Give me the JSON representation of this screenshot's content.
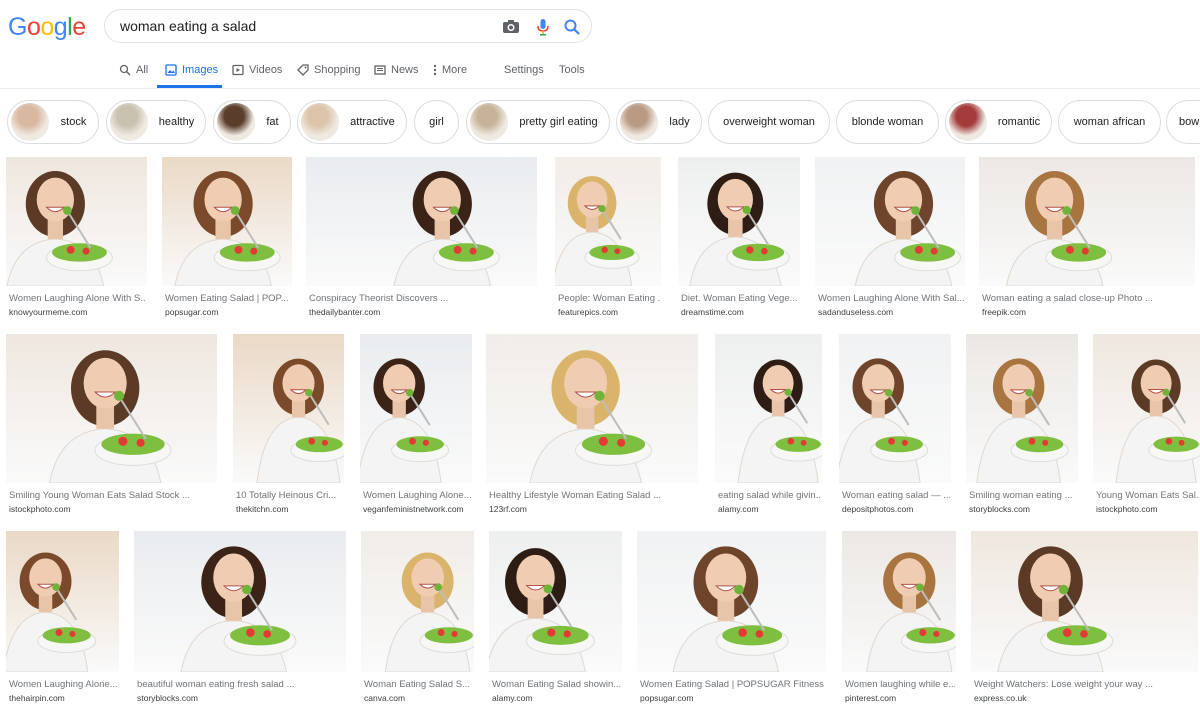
{
  "logo": {
    "text": "Google",
    "letters": [
      {
        "ch": "G",
        "color": "#4285f4"
      },
      {
        "ch": "o",
        "color": "#ea4335"
      },
      {
        "ch": "o",
        "color": "#fbbc05"
      },
      {
        "ch": "g",
        "color": "#4285f4"
      },
      {
        "ch": "l",
        "color": "#34a853"
      },
      {
        "ch": "e",
        "color": "#ea4335"
      }
    ]
  },
  "search": {
    "query": "woman eating a salad",
    "icons": [
      "camera-icon",
      "microphone-icon",
      "search-icon"
    ]
  },
  "tabs": [
    {
      "label": "All",
      "icon": "search-icon"
    },
    {
      "label": "Images",
      "icon": "image-icon",
      "active": true
    },
    {
      "label": "Videos",
      "icon": "play-icon"
    },
    {
      "label": "Shopping",
      "icon": "tag-icon"
    },
    {
      "label": "News",
      "icon": "newspaper-icon"
    },
    {
      "label": "More",
      "icon": "more-vert-icon"
    },
    {
      "label": "Settings"
    },
    {
      "label": "Tools"
    }
  ],
  "chips": [
    {
      "label": "stock",
      "thumb": true
    },
    {
      "label": "healthy",
      "thumb": true
    },
    {
      "label": "fat",
      "thumb": true
    },
    {
      "label": "attractive",
      "thumb": true
    },
    {
      "label": "girl",
      "thumb": false
    },
    {
      "label": "pretty girl eating",
      "thumb": true
    },
    {
      "label": "lady",
      "thumb": true
    },
    {
      "label": "overweight woman",
      "thumb": false
    },
    {
      "label": "blonde woman",
      "thumb": false
    },
    {
      "label": "romantic",
      "thumb": true
    },
    {
      "label": "woman african",
      "thumb": false
    },
    {
      "label": "bow",
      "thumb": false
    }
  ],
  "results": [
    {
      "title": "Women Laughing Alone With S...",
      "source": "knowyourmeme.com"
    },
    {
      "title": "Women Eating Salad | POP...",
      "source": "popsugar.com"
    },
    {
      "title": "Conspiracy Theorist Discovers ...",
      "source": "thedailybanter.com"
    },
    {
      "title": "People: Woman Eating ...",
      "source": "featurepics.com"
    },
    {
      "title": "Diet. Woman Eating Vege...",
      "source": "dreamstime.com"
    },
    {
      "title": "Women Laughing Alone With Sal...",
      "source": "sadanduseless.com"
    },
    {
      "title": "Woman eating a salad close-up Photo ...",
      "source": "freepik.com"
    },
    {
      "title": "Smiling Young Woman Eats Salad Stock ...",
      "source": "istockphoto.com"
    },
    {
      "title": "10 Totally Heinous Cri...",
      "source": "thekitchn.com"
    },
    {
      "title": "Women Laughing Alone...",
      "source": "veganfeministnetwork.com"
    },
    {
      "title": "Healthy Lifestyle Woman Eating Salad ...",
      "source": "123rf.com"
    },
    {
      "title": "eating salad while givin...",
      "source": "alamy.com"
    },
    {
      "title": "Woman eating salad — ...",
      "source": "depositphotos.com"
    },
    {
      "title": "Smiling woman eating ...",
      "source": "storyblocks.com"
    },
    {
      "title": "Young Woman Eats Sal...",
      "source": "istockphoto.com"
    },
    {
      "title": "Women Laughing Alone...",
      "source": "thehairpin.com"
    },
    {
      "title": "beautiful woman eating fresh salad ...",
      "source": "storyblocks.com"
    },
    {
      "title": "Woman Eating Salad S...",
      "source": "canva.com"
    },
    {
      "title": "Woman Eating Salad showin...",
      "source": "alamy.com"
    },
    {
      "title": "Women Eating Salad | POPSUGAR Fitness",
      "source": "popsugar.com"
    },
    {
      "title": "Women laughing while e...",
      "source": "pinterest.com"
    },
    {
      "title": "Weight Watchers: Lose weight your way ...",
      "source": "express.co.uk"
    }
  ]
}
